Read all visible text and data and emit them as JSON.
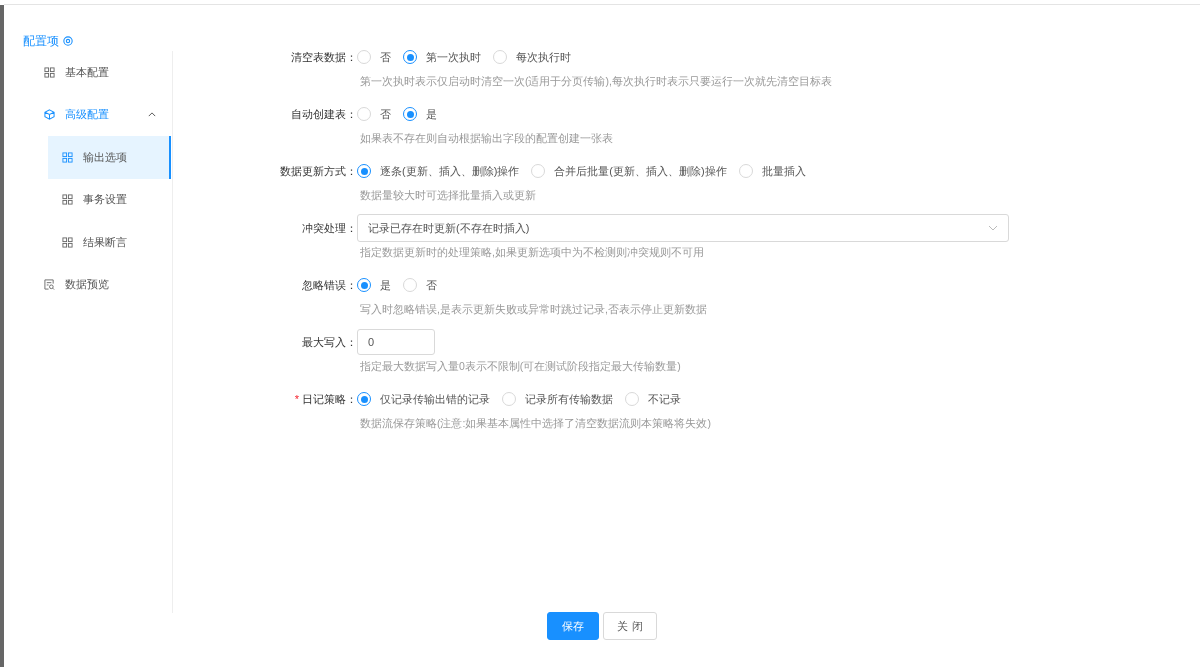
{
  "sidebar": {
    "title": "配置项",
    "items": [
      {
        "label": "基本配置",
        "kind": "grid",
        "selected": false
      },
      {
        "label": "高级配置",
        "kind": "cube",
        "selected": false,
        "expanded": true,
        "children": [
          {
            "label": "输出选项",
            "kind": "grid",
            "selected": true
          },
          {
            "label": "事务设置",
            "kind": "grid",
            "selected": false
          },
          {
            "label": "结果断言",
            "kind": "grid",
            "selected": false
          }
        ]
      },
      {
        "label": "数据预览",
        "kind": "preview",
        "selected": false
      }
    ]
  },
  "form": [
    {
      "label": "清空表数据：",
      "kind": "radio",
      "options": [
        {
          "label": "否",
          "selected": false
        },
        {
          "label": "第一次执时",
          "selected": true
        },
        {
          "label": "每次执行时",
          "selected": false
        }
      ],
      "help": "第一次执时表示仅启动时清空一次(适用于分页传输),每次执行时表示只要运行一次就先清空目标表"
    },
    {
      "label": "自动创建表：",
      "kind": "radio",
      "options": [
        {
          "label": "否",
          "selected": false
        },
        {
          "label": "是",
          "selected": true
        }
      ],
      "help": "如果表不存在则自动根据输出字段的配置创建一张表"
    },
    {
      "label": "数据更新方式：",
      "kind": "radio",
      "options": [
        {
          "label": "逐条(更新、插入、删除)操作",
          "selected": true
        },
        {
          "label": "合并后批量(更新、插入、删除)操作",
          "selected": false
        },
        {
          "label": "批量插入",
          "selected": false
        }
      ],
      "help": "数据量较大时可选择批量插入或更新"
    },
    {
      "label": "冲突处理：",
      "kind": "select",
      "value": "记录已存在时更新(不存在时插入)",
      "help": "指定数据更新时的处理策略,如果更新选项中为不检测则冲突规则不可用"
    },
    {
      "label": "忽略错误：",
      "kind": "radio",
      "options": [
        {
          "label": "是",
          "selected": true
        },
        {
          "label": "否",
          "selected": false
        }
      ],
      "help": "写入时忽略错误,是表示更新失败或异常时跳过记录,否表示停止更新数据"
    },
    {
      "label": "最大写入：",
      "kind": "input",
      "value": "0",
      "help": "指定最大数据写入量0表示不限制(可在测试阶段指定最大传输数量)"
    },
    {
      "label": "日记策略：",
      "kind": "radio",
      "required_mark": "*",
      "options": [
        {
          "label": "仅记录传输出错的记录",
          "selected": true
        },
        {
          "label": "记录所有传输数据",
          "selected": false
        },
        {
          "label": "不记录",
          "selected": false
        }
      ],
      "help": "数据流保存策略(注意:如果基本属性中选择了清空数据流则本策略将失效)"
    }
  ],
  "buttons": [
    {
      "label": "保存",
      "kind": "primary"
    },
    {
      "label": "关 闭",
      "kind": "default"
    }
  ]
}
